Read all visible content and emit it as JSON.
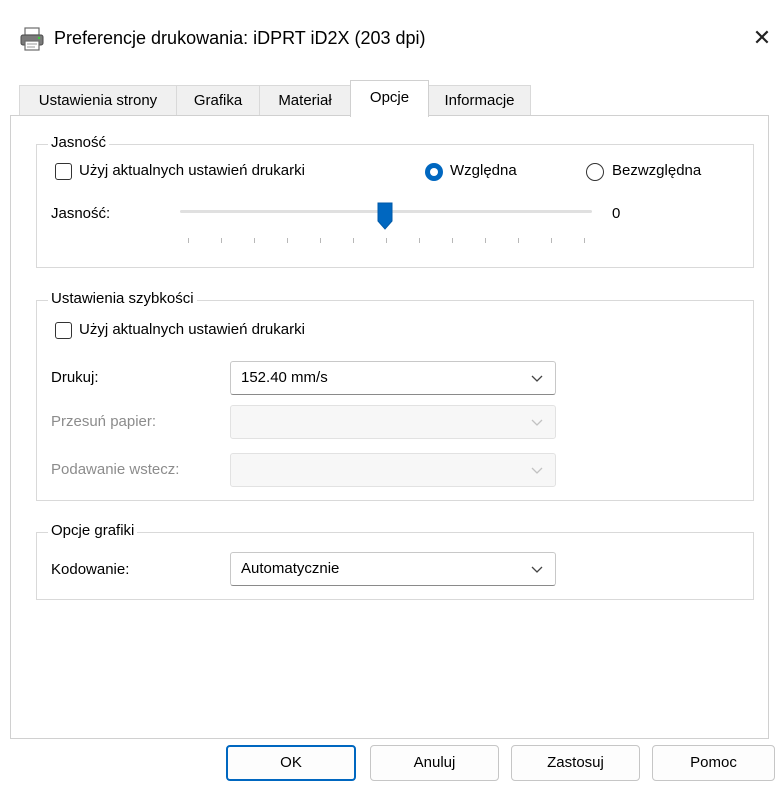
{
  "window": {
    "title": "Preferencje drukowania: iDPRT iD2X (203 dpi)",
    "close_symbol": "✕"
  },
  "tabs": [
    {
      "label": "Ustawienia strony",
      "active": false
    },
    {
      "label": "Grafika",
      "active": false
    },
    {
      "label": "Materiał",
      "active": false
    },
    {
      "label": "Opcje",
      "active": true
    },
    {
      "label": "Informacje",
      "active": false
    }
  ],
  "brightness": {
    "group_label": "Jasność",
    "use_printer_settings_label": "Użyj aktualnych ustawień drukarki",
    "use_printer_settings_checked": false,
    "mode_relative_label": "Względna",
    "mode_absolute_label": "Bezwzględna",
    "selected_mode": "Względna",
    "slider_label": "Jasność:",
    "slider_value": "0"
  },
  "speed": {
    "group_label": "Ustawienia szybkości",
    "use_printer_settings_label": "Użyj aktualnych ustawień drukarki",
    "use_printer_settings_checked": false,
    "print_label": "Drukuj:",
    "print_value": "152.40 mm/s",
    "feed_label": "Przesuń papier:",
    "feed_value": "",
    "backfeed_label": "Podawanie wstecz:",
    "backfeed_value": ""
  },
  "graphics": {
    "group_label": "Opcje grafiki",
    "encoding_label": "Kodowanie:",
    "encoding_value": "Automatycznie"
  },
  "buttons": {
    "ok": "OK",
    "cancel": "Anuluj",
    "apply": "Zastosuj",
    "help": "Pomoc"
  },
  "colors": {
    "accent": "#0067c0",
    "disabled_text": "#8c8c8c"
  }
}
